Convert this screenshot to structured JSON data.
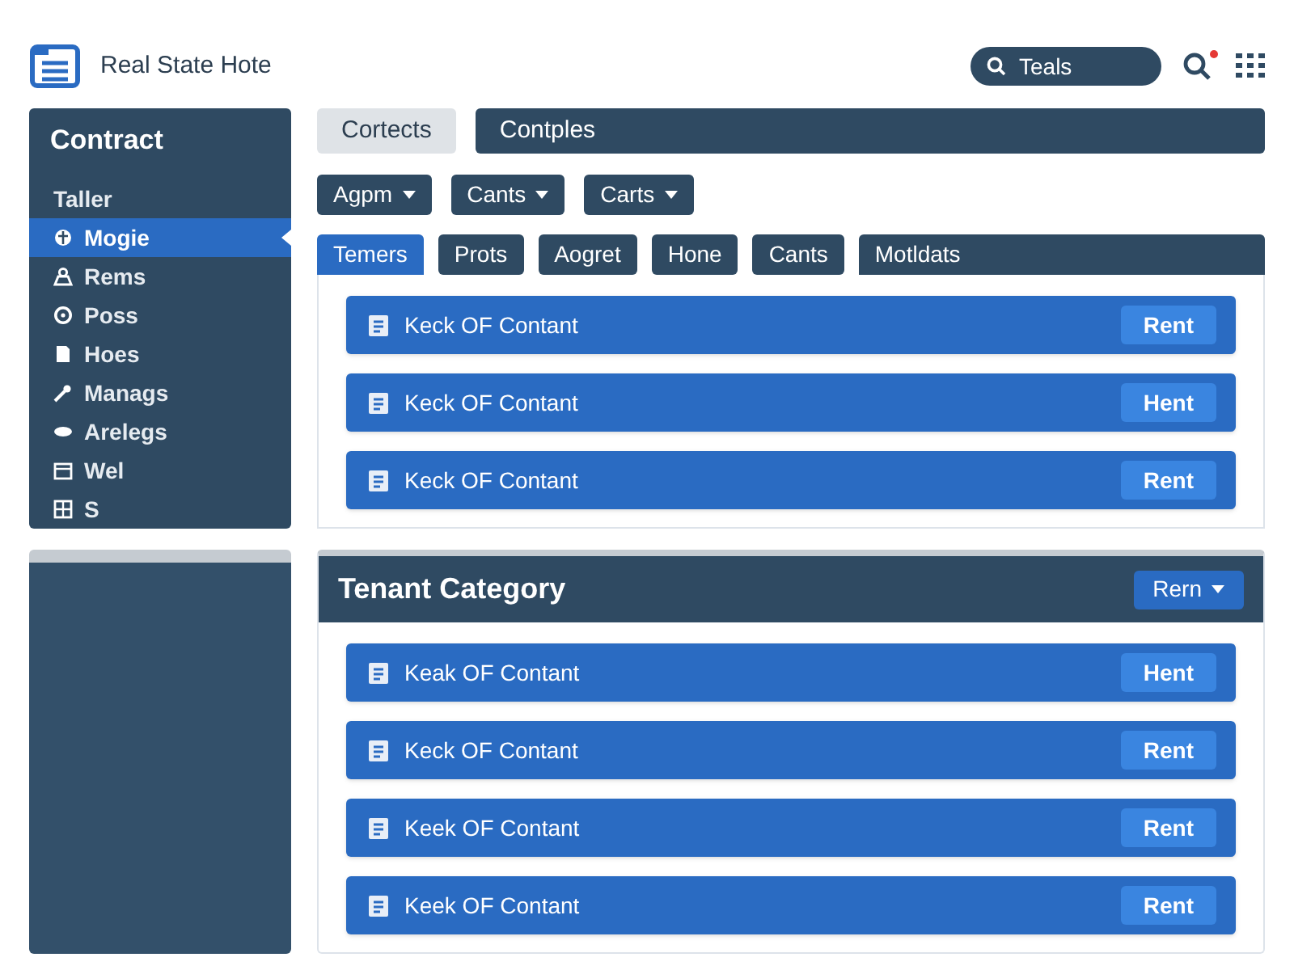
{
  "app": {
    "title": "Real State Hote",
    "search": {
      "value": "Teals"
    },
    "notification": true
  },
  "sidebar": {
    "title": "Contract",
    "items": [
      {
        "label": "Taller",
        "selected": false
      },
      {
        "label": "Mogie",
        "selected": true
      },
      {
        "label": "Rems",
        "selected": false
      },
      {
        "label": "Poss",
        "selected": false
      },
      {
        "label": "Hoes",
        "selected": false
      },
      {
        "label": "Manags",
        "selected": false
      },
      {
        "label": "Arelegs",
        "selected": false
      },
      {
        "label": "Wel",
        "selected": false
      },
      {
        "label": "S",
        "selected": false
      }
    ]
  },
  "top_tabs": [
    {
      "label": "Cortects",
      "selected": true
    },
    {
      "label": "Contples",
      "selected": false
    }
  ],
  "filters": [
    {
      "label": "Agpm"
    },
    {
      "label": "Cants"
    },
    {
      "label": "Carts"
    }
  ],
  "tabs": [
    {
      "label": "Temers",
      "selected": true
    },
    {
      "label": "Prots",
      "selected": false
    },
    {
      "label": "Aogret",
      "selected": false
    },
    {
      "label": "Hone",
      "selected": false
    },
    {
      "label": "Cants",
      "selected": false
    },
    {
      "label": "Motldats",
      "selected": false
    }
  ],
  "top_items": [
    {
      "label": "Keck OF Contant",
      "action": "Rent"
    },
    {
      "label": "Keck OF Contant",
      "action": "Hent"
    },
    {
      "label": "Keck OF Contant",
      "action": "Rent"
    }
  ],
  "category": {
    "title": "Tenant Category",
    "menu": "Rern",
    "items": [
      {
        "label": "Keak OF Contant",
        "action": "Hent"
      },
      {
        "label": "Keck OF Contant",
        "action": "Rent"
      },
      {
        "label": "Keek OF Contant",
        "action": "Rent"
      },
      {
        "label": "Keek OF Contant",
        "action": "Rent"
      }
    ]
  }
}
